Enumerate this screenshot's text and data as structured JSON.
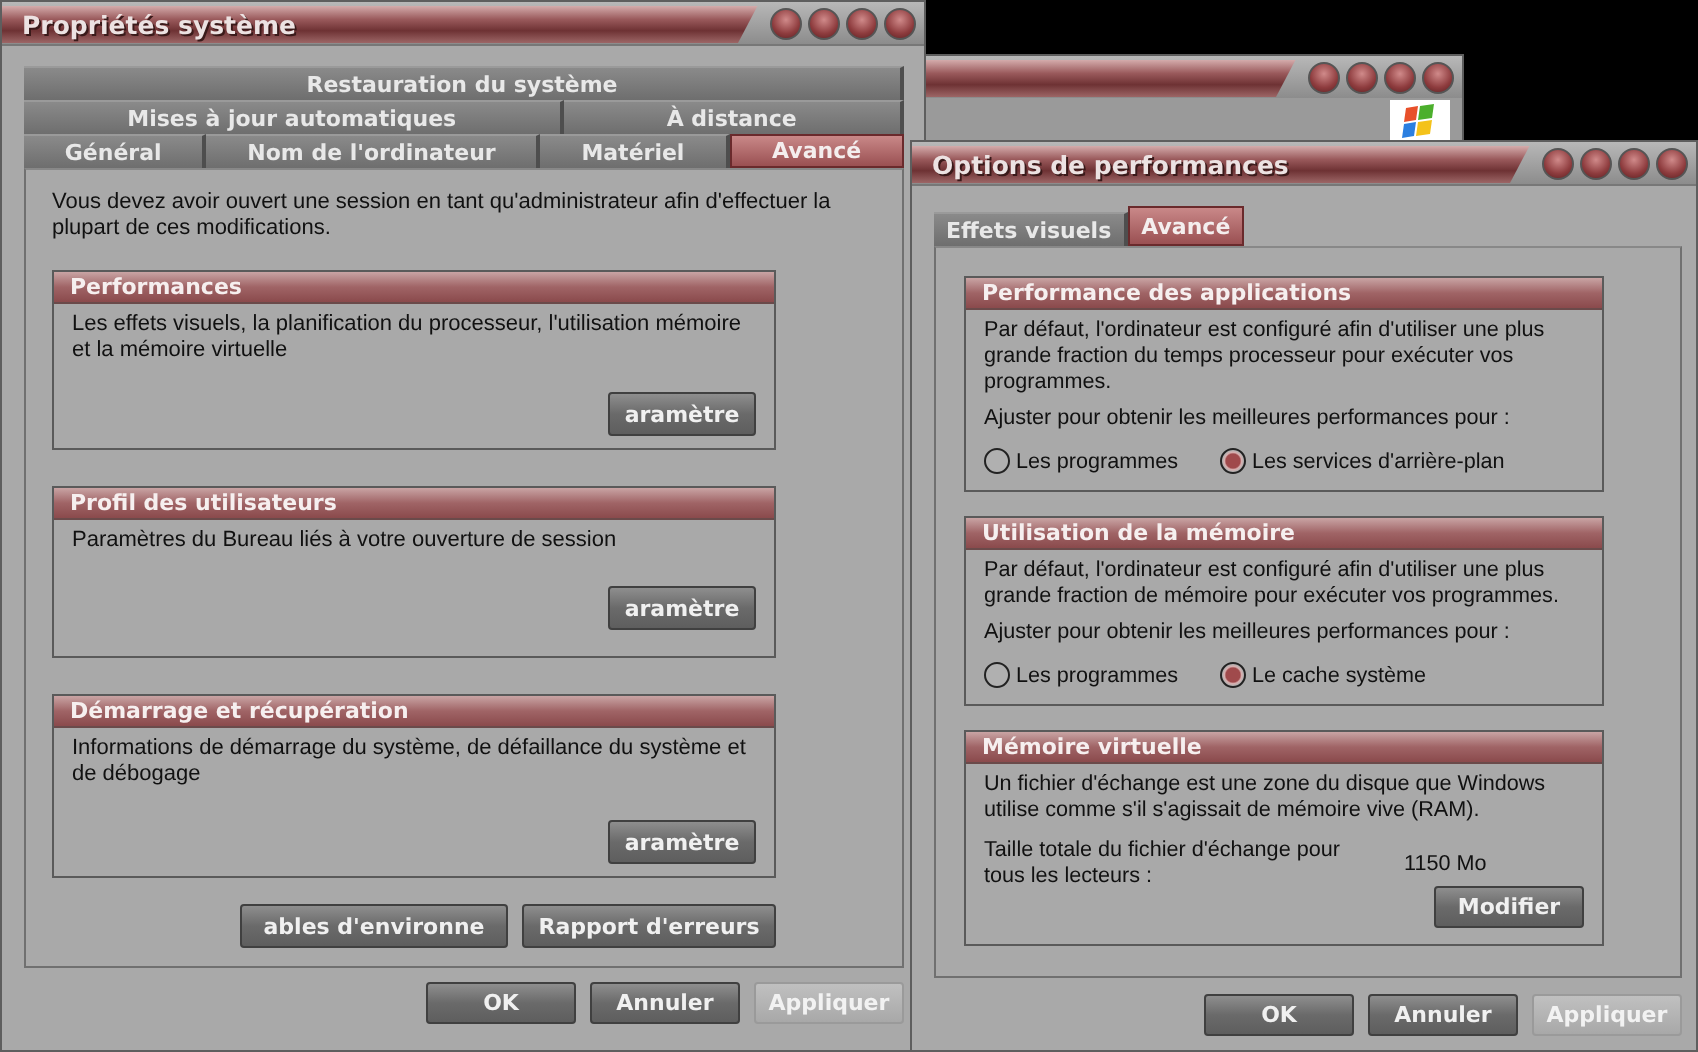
{
  "system_properties": {
    "title": "Propriétés système",
    "tab_rows": [
      [
        {
          "label": "Restauration du système",
          "selected": false
        }
      ],
      [
        {
          "label": "Mises à jour automatiques",
          "selected": false
        },
        {
          "label": "À distance",
          "selected": false
        }
      ],
      [
        {
          "label": "Général",
          "selected": false
        },
        {
          "label": "Nom de l'ordinateur",
          "selected": false
        },
        {
          "label": "Matériel",
          "selected": false
        },
        {
          "label": "Avancé",
          "selected": true
        }
      ]
    ],
    "notice": "Vous devez avoir ouvert une session en tant qu'administrateur afin d'effectuer la plupart de ces modifications.",
    "groups": [
      {
        "title": "Performances",
        "text": "Les effets visuels, la planification du processeur, l'utilisation mémoire et la mémoire virtuelle",
        "button": "aramètre"
      },
      {
        "title": "Profil des utilisateurs",
        "text": "Paramètres du Bureau liés à votre ouverture de session",
        "button": "aramètre"
      },
      {
        "title": "Démarrage et récupération",
        "text": "Informations de démarrage du système, de défaillance du système et de débogage",
        "button": "aramètre"
      }
    ],
    "extra_buttons": [
      "ables d'environne",
      "Rapport d'erreurs"
    ],
    "buttons": [
      {
        "label": "OK",
        "disabled": false
      },
      {
        "label": "Annuler",
        "disabled": false
      },
      {
        "label": "Appliquer",
        "disabled": true
      }
    ]
  },
  "performance_options": {
    "title": "Options de performances",
    "tabs": [
      {
        "label": "Effets visuels",
        "selected": false
      },
      {
        "label": "Avancé",
        "selected": true
      }
    ],
    "groups": [
      {
        "kind": "radio",
        "title": "Performance des applications",
        "text": "Par défaut, l'ordinateur est configuré afin d'utiliser une plus grande fraction du temps processeur pour exécuter vos programmes.",
        "prompt": "Ajuster pour obtenir les meilleures performances pour :",
        "options": [
          {
            "label": "Les programmes",
            "selected": false
          },
          {
            "label": "Les services d'arrière-plan",
            "selected": true
          }
        ]
      },
      {
        "kind": "radio",
        "title": "Utilisation de la mémoire",
        "text": "Par défaut, l'ordinateur est configuré afin d'utiliser une plus grande fraction de mémoire pour exécuter vos programmes.",
        "prompt": "Ajuster pour obtenir les meilleures performances pour :",
        "options": [
          {
            "label": "Les programmes",
            "selected": false
          },
          {
            "label": "Le cache système",
            "selected": true
          }
        ]
      },
      {
        "kind": "info",
        "title": "Mémoire virtuelle",
        "text": "Un fichier d'échange est une zone du disque que Windows utilise comme s'il s'agissait de mémoire vive (RAM).",
        "size_label": "Taille totale du fichier d'échange pour tous les lecteurs :",
        "size_value": "1150 Mo",
        "button": "Modifier"
      }
    ],
    "buttons": [
      {
        "label": "OK",
        "disabled": false
      },
      {
        "label": "Annuler",
        "disabled": false
      },
      {
        "label": "Appliquer",
        "disabled": true
      }
    ]
  }
}
